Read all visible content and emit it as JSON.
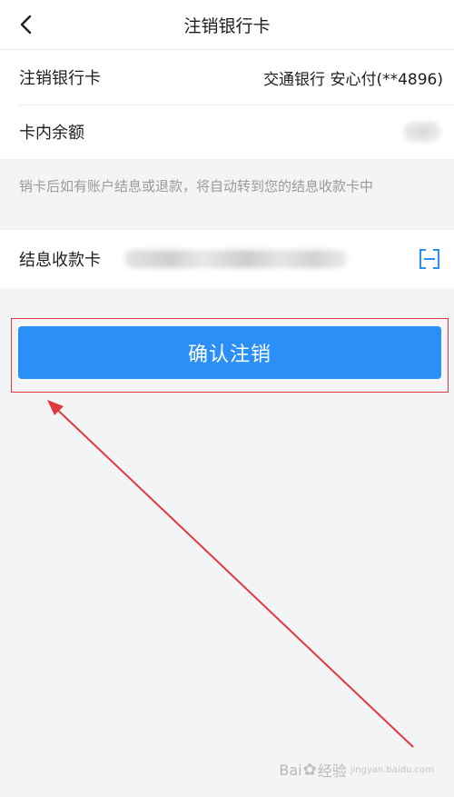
{
  "nav": {
    "title": "注销银行卡"
  },
  "rows": {
    "bank_card_label": "注销银行卡",
    "bank_card_value": "交通银行 安心付(**4896)",
    "balance_label": "卡内余额"
  },
  "notice": {
    "text": "销卡后如有账户结息或退款，将自动转到您的结息收款卡中"
  },
  "interest_card": {
    "label": "结息收款卡"
  },
  "confirm": {
    "label": "确认注销"
  },
  "watermark": {
    "brand_a": "Bai",
    "brand_b": "经验",
    "sub": "jingyan.baidu.com"
  },
  "colors": {
    "primary_button": "#2a8ff7",
    "highlight": "#e0393b",
    "background": "#f3f4f6"
  },
  "icons": {
    "back": "chevron-left-icon",
    "scan": "scan-icon",
    "watermark": "paw-icon"
  }
}
